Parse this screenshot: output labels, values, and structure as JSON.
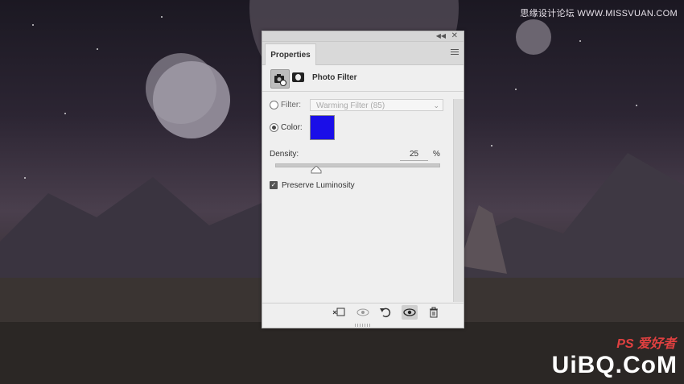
{
  "background": {
    "watermark_top": "思缘设计论坛 WWW.MISSVUAN.COM",
    "watermark_bottom_prefix": "UiBQ",
    "watermark_bottom_suffix": ".CoM",
    "watermark_ps": "PS 爱好者"
  },
  "panel": {
    "tab_label": "Properties",
    "header_title": "Photo Filter",
    "filter_label": "Filter:",
    "filter_value": "Warming Filter (85)",
    "color_label": "Color:",
    "color_value": "#1a0ee8",
    "density_label": "Density:",
    "density_value": "25",
    "density_unit": "%",
    "density_fraction": 0.25,
    "preserve_label": "Preserve Luminosity",
    "preserve_checked": true,
    "selected_option": "color"
  },
  "icons": {
    "collapse": "double-chevron-icon",
    "close": "close-icon",
    "panel_menu": "hamburger-menu-icon",
    "adjustment": "camera-filter-icon",
    "mask": "layer-mask-icon",
    "clip": "clip-to-layer-icon",
    "view_previous": "view-previous-icon",
    "reset": "reset-icon",
    "visibility": "eye-icon",
    "delete": "trash-icon"
  }
}
